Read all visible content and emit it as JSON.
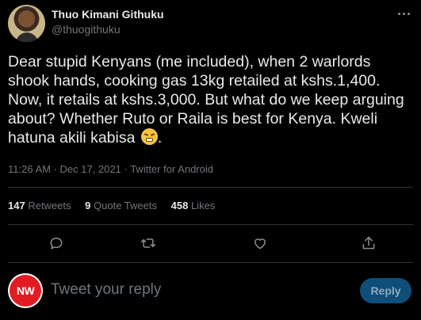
{
  "author": {
    "name": "Thuo Kimani Githuku",
    "handle": "@thuogithuku"
  },
  "tweet": {
    "text": "Dear stupid Kenyans (me included), when 2 warlords shook hands, cooking gas 13kg retailed at kshs.1,400. Now, it retails at kshs.3,000. But what do we keep arguing about? Whether Ruto or Raila is best for Kenya. Kweli hatuna akili kabisa ",
    "emoji": "face-with-steam-from-nose",
    "trailing": "."
  },
  "meta": {
    "time": "11:26 AM",
    "sep1": " · ",
    "date": "Dec 17, 2021",
    "sep2": " · ",
    "source": "Twitter for Android"
  },
  "stats": {
    "retweets_count": "147",
    "retweets_label": "Retweets",
    "quotes_count": "9",
    "quotes_label": "Quote Tweets",
    "likes_count": "458",
    "likes_label": "Likes"
  },
  "actions": [
    "reply-icon",
    "retweet-icon",
    "like-icon",
    "share-icon"
  ],
  "reply": {
    "avatar_text": "NW",
    "placeholder": "Tweet your reply",
    "button_label": "Reply"
  },
  "colors": {
    "background": "#000000",
    "text": "#e7e9ea",
    "secondary": "#71767b",
    "reply_button": "#0f4e78",
    "avatar_red": "#e21b23"
  }
}
